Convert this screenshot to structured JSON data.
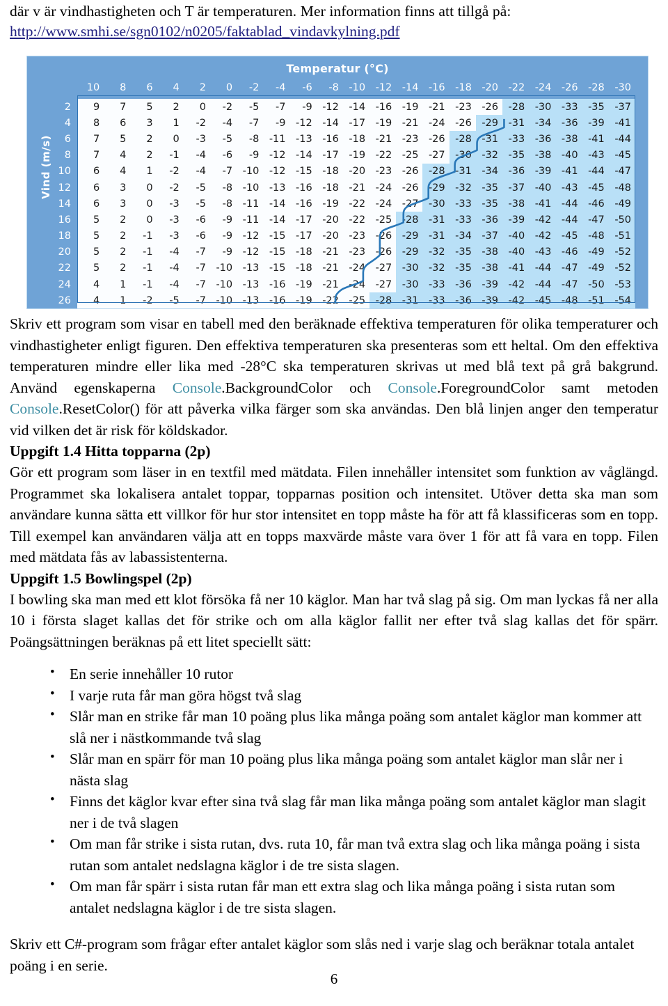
{
  "intro": {
    "line1": "där v är vindhastigheten och T är temperaturen. Mer information finns att tillgå på:",
    "url": "http://www.smhi.se/sgn0102/n0205/faktablad_vindavkylning.pdf"
  },
  "figure": {
    "title": "Temperatur (°C)",
    "y_axis_label": "Vind (m/s)",
    "threshold_note": "Den blå linjen anger den temperatur vid vilken det är risk för köldskador.",
    "threshold_value": -28,
    "colors": {
      "panel_blue": "#6fa3d6",
      "cold_region": "#b9e0f7",
      "cell_bg": "#fbfdff",
      "curve_line": "#2a78b8",
      "frame": "#2f74b5"
    }
  },
  "chart_data": {
    "type": "table",
    "title": "Temperatur (°C)",
    "xlabel": "Temperatur (°C)",
    "ylabel": "Vind (m/s)",
    "categories": [
      10,
      8,
      6,
      4,
      2,
      0,
      -2,
      -4,
      -6,
      -8,
      -10,
      -12,
      -14,
      -16,
      -18,
      -20,
      -22,
      -24,
      -26,
      -28,
      -30
    ],
    "row_labels": [
      2,
      4,
      6,
      8,
      10,
      12,
      14,
      16,
      18,
      20,
      22,
      24,
      26
    ],
    "series": [
      {
        "name": "2",
        "values": [
          9,
          7,
          5,
          2,
          0,
          -2,
          -5,
          -7,
          -9,
          -12,
          -14,
          -16,
          -19,
          -21,
          -23,
          -26,
          -28,
          -30,
          -33,
          -35,
          -37
        ]
      },
      {
        "name": "4",
        "values": [
          8,
          6,
          3,
          1,
          -2,
          -4,
          -7,
          -9,
          -12,
          -14,
          -17,
          -19,
          -21,
          -24,
          -26,
          -29,
          -31,
          -34,
          -36,
          -39,
          -41
        ]
      },
      {
        "name": "6",
        "values": [
          7,
          5,
          2,
          0,
          -3,
          -5,
          -8,
          -11,
          -13,
          -16,
          -18,
          -21,
          -23,
          -26,
          -28,
          -31,
          -33,
          -36,
          -38,
          -41,
          -44
        ]
      },
      {
        "name": "8",
        "values": [
          7,
          4,
          2,
          -1,
          -4,
          -6,
          -9,
          -12,
          -14,
          -17,
          -19,
          -22,
          -25,
          -27,
          -30,
          -32,
          -35,
          -38,
          -40,
          -43,
          -45
        ]
      },
      {
        "name": "10",
        "values": [
          6,
          4,
          1,
          -2,
          -4,
          -7,
          -10,
          -12,
          -15,
          -18,
          -20,
          -23,
          -26,
          -28,
          -31,
          -34,
          -36,
          -39,
          -41,
          -44,
          -47
        ]
      },
      {
        "name": "12",
        "values": [
          6,
          3,
          0,
          -2,
          -5,
          -8,
          -10,
          -13,
          -16,
          -18,
          -21,
          -24,
          -26,
          -29,
          -32,
          -35,
          -37,
          -40,
          -43,
          -45,
          -48
        ]
      },
      {
        "name": "14",
        "values": [
          6,
          3,
          0,
          -3,
          -5,
          -8,
          -11,
          -14,
          -16,
          -19,
          -22,
          -24,
          -27,
          -30,
          -33,
          -35,
          -38,
          -41,
          -44,
          -46,
          -49
        ]
      },
      {
        "name": "16",
        "values": [
          5,
          2,
          0,
          -3,
          -6,
          -9,
          -11,
          -14,
          -17,
          -20,
          -22,
          -25,
          -28,
          -31,
          -33,
          -36,
          -39,
          -42,
          -44,
          -47,
          -50
        ]
      },
      {
        "name": "18",
        "values": [
          5,
          2,
          -1,
          -3,
          -6,
          -9,
          -12,
          -15,
          -17,
          -20,
          -23,
          -26,
          -29,
          -31,
          -34,
          -37,
          -40,
          -42,
          -45,
          -48,
          -51
        ]
      },
      {
        "name": "20",
        "values": [
          5,
          2,
          -1,
          -4,
          -7,
          -9,
          -12,
          -15,
          -18,
          -21,
          -23,
          -26,
          -29,
          -32,
          -35,
          -38,
          -40,
          -43,
          -46,
          -49,
          -52
        ]
      },
      {
        "name": "22",
        "values": [
          5,
          2,
          -1,
          -4,
          -7,
          -10,
          -13,
          -15,
          -18,
          -21,
          -24,
          -27,
          -30,
          -32,
          -35,
          -38,
          -41,
          -44,
          -47,
          -49,
          -52
        ]
      },
      {
        "name": "24",
        "values": [
          4,
          1,
          -1,
          -4,
          -7,
          -10,
          -13,
          -16,
          -19,
          -21,
          -24,
          -27,
          -30,
          -33,
          -36,
          -39,
          -42,
          -44,
          -47,
          -50,
          -53
        ]
      },
      {
        "name": "26",
        "values": [
          4,
          1,
          -2,
          -5,
          -7,
          -10,
          -13,
          -16,
          -19,
          -22,
          -25,
          -28,
          -31,
          -33,
          -36,
          -39,
          -42,
          -45,
          -48,
          -51,
          -54
        ]
      }
    ],
    "grid": true,
    "legend": "none"
  },
  "body": {
    "para1_plain_a": "Skriv ett program som visar en tabell med den beräknade effektiva temperaturen för olika temperaturer och vindhastigheter enligt figuren. Den effektiva temperaturen ska presenteras som ett heltal. Om den effektiva temperaturen mindre eller lika med -28°C ska temperaturen skrivas ut med blå text på grå bakgrund. Använd egenskaperna ",
    "kw1": "Console",
    "para1_plain_b": ".BackgroundColor och ",
    "kw2": "Console",
    "para1_plain_c": ".ForegroundColor samt metoden ",
    "kw3": "Console",
    "para1_plain_d": ".ResetColor() för att påverka vilka färger som ska användas. Den blå linjen anger den temperatur vid vilken det är risk för köldskador."
  },
  "task14": {
    "heading": "Uppgift 1.4 Hitta topparna (2p)",
    "text": "Gör ett program som läser in en textfil med mätdata. Filen innehåller intensitet som funktion av våglängd. Programmet ska lokalisera antalet toppar, topparnas position och intensitet. Utöver detta ska man som användare kunna sätta ett villkor för hur stor intensitet en topp måste ha för att få klassificeras som en topp. Till exempel kan användaren välja att en topps maxvärde måste vara över 1 för att få vara en topp. Filen med mätdata fås av labassistenterna."
  },
  "task15": {
    "heading": "Uppgift 1.5 Bowlingspel (2p)",
    "intro": "I bowling ska man med ett klot försöka få ner 10 käglor. Man har två slag på sig. Om man lyckas få ner alla 10 i första slaget kallas det för strike och om alla käglor fallit ner efter två slag kallas det för spärr. Poängsättningen beräknas på ett litet speciellt sätt:",
    "bullets": [
      "En serie innehåller 10 rutor",
      "I varje ruta får man göra högst två slag",
      "Slår man en strike får man 10 poäng plus lika många poäng som antalet käglor man kommer att slå ner i nästkommande två slag",
      "Slår man en spärr för man 10 poäng plus lika många poäng som antalet käglor man slår ner i nästa slag",
      "Finns det käglor kvar efter sina två slag får man lika många poäng som antalet käglor man slagit ner i de två slagen",
      "Om man får strike i sista rutan, dvs. ruta 10, får man två extra slag och lika många poäng i sista rutan som antalet nedslagna käglor i de tre sista slagen.",
      "Om man får spärr i sista rutan får man ett extra slag och lika många poäng i sista rutan som antalet nedslagna käglor i de tre sista slagen."
    ],
    "closing": "Skriv ett C#-program som frågar efter antalet käglor som slås ned i varje slag och beräknar totala antalet poäng i en serie."
  },
  "footer": {
    "page_number": "6"
  }
}
